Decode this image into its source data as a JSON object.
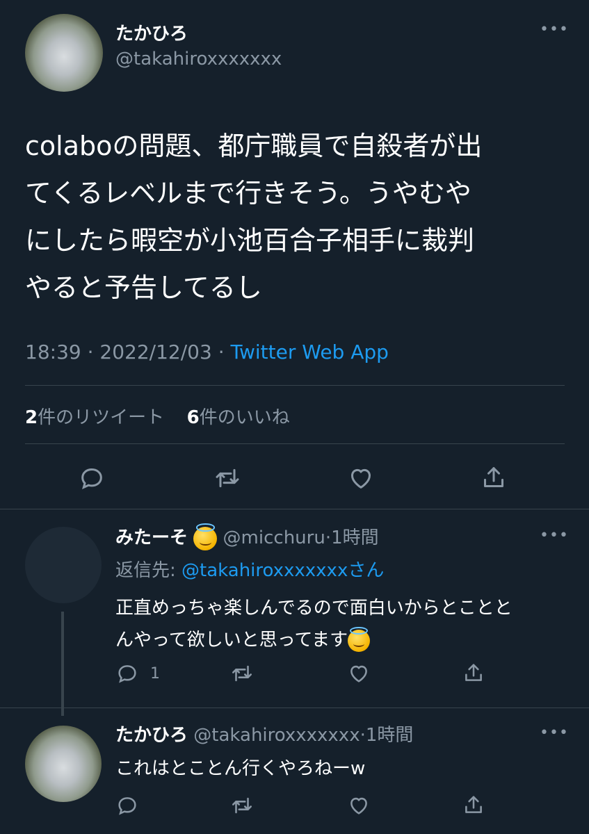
{
  "main_tweet": {
    "display_name": "たかひろ",
    "handle": "@takahiroxxxxxxx",
    "text_lines": [
      "colaboの問題、都庁職員で自殺者が出",
      "てくるレベルまで行きそう。うやむや",
      "にしたら暇空が小池百合子相手に裁判",
      "やると予告してるし"
    ],
    "time": "18:39",
    "sep1": "·",
    "date": "2022/12/03",
    "sep2": "·",
    "source": "Twitter Web App",
    "retweet_count": "2",
    "retweet_label": "件のリツイート",
    "like_count": "6",
    "like_label": "件のいいね"
  },
  "reply1": {
    "display_name": "みたーそ",
    "handle": "@micchuru",
    "sep": "·",
    "time": "1時間",
    "reply_to_label": "返信先:",
    "reply_to_handle": "@takahiroxxxxxxx",
    "reply_to_suffix": "さん",
    "text_lines": [
      "正直めっちゃ楽しんでるので面白いからとことと",
      "んやって欲しいと思ってます"
    ],
    "reply_count": "1"
  },
  "reply2": {
    "display_name": "たかひろ",
    "handle": "@takahiroxxxxxxx",
    "sep": "·",
    "time": "1時間",
    "text": "これはとことん行くやろねーw"
  },
  "icons": {
    "more": "more-icon",
    "reply": "reply-icon",
    "retweet": "retweet-icon",
    "like": "heart-icon",
    "share": "share-icon"
  },
  "colors": {
    "background": "#15202b",
    "text": "#ffffff",
    "muted": "#8b98a5",
    "accent": "#1d9bf0",
    "divider": "#38444d"
  }
}
